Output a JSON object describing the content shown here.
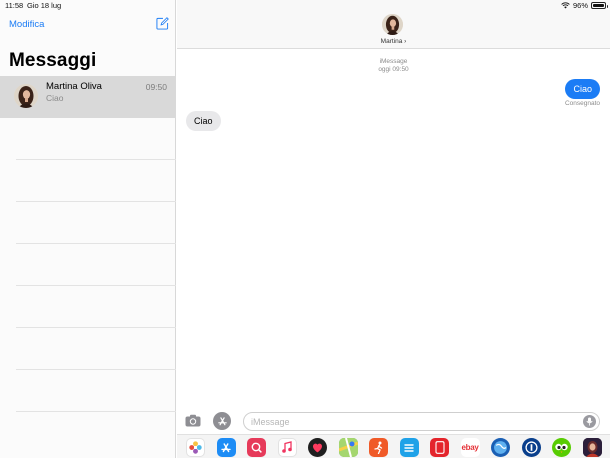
{
  "status_bar": {
    "time": "11:58",
    "date": "Gio 18 lug",
    "battery": "96%",
    "battery_level": 0.96
  },
  "sidebar": {
    "edit_label": "Modifica",
    "title": "Messaggi",
    "conversations": [
      {
        "name": "Martina Oliva",
        "time": "09:50",
        "preview": "Ciao"
      }
    ]
  },
  "chat": {
    "contact_name": "Martina ›",
    "service_label": "iMessage",
    "timestamp": "oggi 09:50",
    "messages": [
      {
        "direction": "outgoing",
        "text": "Ciao"
      },
      {
        "direction": "incoming",
        "text": "Ciao"
      }
    ],
    "delivery_status": "Consegnato",
    "input_placeholder": "iMessage"
  },
  "app_drawer": {
    "apps": [
      {
        "icon": "photos-icon",
        "color": "#ffffff"
      },
      {
        "icon": "app-store-icon",
        "color": "#1d8cf5"
      },
      {
        "icon": "images-search-icon",
        "color": "#e63a5a"
      },
      {
        "icon": "music-icon",
        "color": "#ffffff"
      },
      {
        "icon": "digital-touch-icon",
        "color": "#1f1f1f"
      },
      {
        "icon": "maps-icon",
        "color": "#4caf50"
      },
      {
        "icon": "runner-icon",
        "color": "#f05a28"
      },
      {
        "icon": "list-icon",
        "color": "#1fa2e8"
      },
      {
        "icon": "phone-app-icon",
        "color": "#e4252c"
      },
      {
        "icon": "ebay-icon",
        "label": "ebay",
        "color": "#ffffff"
      },
      {
        "icon": "globe-icon",
        "color": "#1a5fb4"
      },
      {
        "icon": "password-icon",
        "color": "#0a3f8c"
      },
      {
        "icon": "duolingo-icon",
        "color": "#58cc02"
      },
      {
        "icon": "avatar-app-icon",
        "color": "#2b1e3a"
      },
      {
        "icon": "green-app-icon",
        "color": "#58cc02"
      }
    ]
  }
}
